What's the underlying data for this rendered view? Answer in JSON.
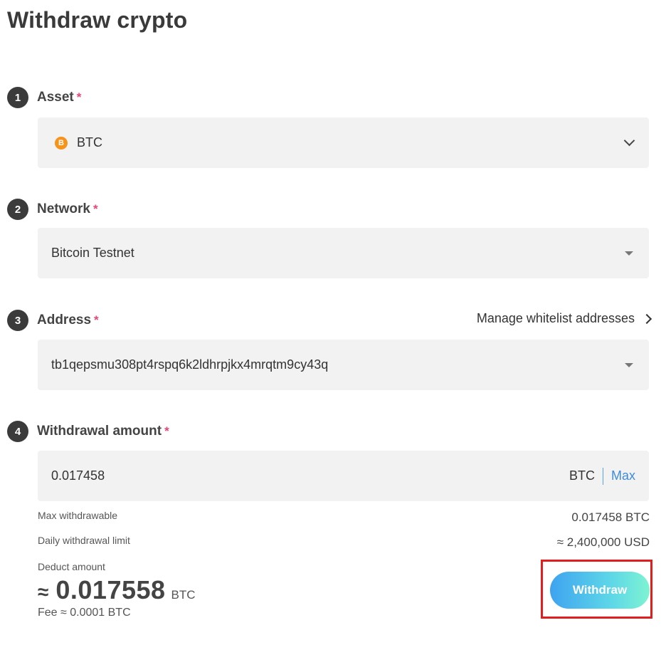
{
  "page": {
    "title": "Withdraw crypto"
  },
  "steps": [
    {
      "number": "1",
      "label": "Asset",
      "required": "*"
    },
    {
      "number": "2",
      "label": "Network",
      "required": "*"
    },
    {
      "number": "3",
      "label": "Address",
      "required": "*"
    },
    {
      "number": "4",
      "label": "Withdrawal amount",
      "required": "*"
    }
  ],
  "asset": {
    "icon": "bitcoin-icon",
    "icon_glyph": "B",
    "value": "BTC"
  },
  "network": {
    "value": "Bitcoin Testnet"
  },
  "address": {
    "value": "tb1qepsmu308pt4rspq6k2ldhrpjkx4mrqtm9cy43q",
    "manage_link": "Manage whitelist addresses"
  },
  "amount": {
    "value": "0.017458",
    "unit": "BTC",
    "max_label": "Max"
  },
  "info": {
    "max_withdrawable_label": "Max withdrawable",
    "max_withdrawable_value": "0.017458 BTC",
    "daily_limit_label": "Daily withdrawal limit",
    "daily_limit_value": "≈ 2,400,000 USD"
  },
  "deduct": {
    "label": "Deduct amount",
    "approx": "≈",
    "value": "0.017558",
    "unit": "BTC",
    "fee": "Fee ≈ 0.0001 BTC"
  },
  "withdraw_button": {
    "label": "Withdraw"
  },
  "colors": {
    "required": "#e8457a",
    "link": "#3d8be0",
    "highlight": "#e01e1e",
    "button_gradient_start": "#3ea3f0",
    "button_gradient_end": "#7ef3d2"
  }
}
